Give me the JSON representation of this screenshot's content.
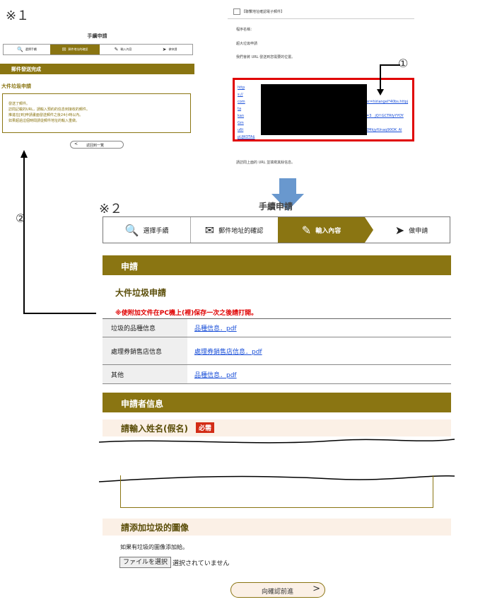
{
  "notes": {
    "n1": "※１",
    "n2": "※２",
    "circle1": "①",
    "circle2": "②"
  },
  "left_panel": {
    "title": "手續申請",
    "steps": [
      "選擇手續",
      "郵件地址的確認",
      "輸入內容",
      "做申請"
    ],
    "banner": "郵件發送完成",
    "subtitle": "大件垃圾申請",
    "box_lines": [
      "發送了郵件。",
      "訪問記載的URL，請輸入預約的信息到接收的郵件。",
      "推進在[到]申請畫面發送郵件之後24小時以內。",
      "如果超過這個時間請從郵件地址的輸入重做。"
    ],
    "back_button": "返回到一覽"
  },
  "email": {
    "header": "【聯繫地址確認電子郵件】",
    "line1": "程序名稱：",
    "line2": "超大垃圾申請",
    "line3": "我們會將 URL 發送到您需要的位置。",
    "url_parts": [
      "http",
      "s://",
      "com",
      "ta",
      "kan",
      "Gm",
      "u6t",
      "pUJKOTA$"
    ],
    "url_right": [
      "er=hiriangel*40bs.httpj",
      "=3__jQ!!GCTRfyYYOY",
      "2MkjyfUnaq90OK_Al"
    ],
    "footer": "請訪問上面的 URL 並填寫其餘信息。"
  },
  "main": {
    "title": "手續申請",
    "steps": [
      {
        "label": "選擇手續",
        "icon": "search-icon"
      },
      {
        "label": "郵件地址的確認",
        "icon": "envelope-icon"
      },
      {
        "label": "輸入內容",
        "icon": "pencil-icon"
      },
      {
        "label": "做申請",
        "icon": "send-icon"
      }
    ],
    "section1": "申請",
    "subtitle": "大件垃圾申請",
    "warning": "※使附加文件在PC機上(裡)保存一次之後請打開。",
    "rows": [
      {
        "label": "垃圾的品種信息",
        "value": "品種信息．pdf"
      },
      {
        "label": "處理券銷售店信息",
        "value": "處理券銷售店信息．pdf"
      },
      {
        "label": "其他",
        "value": "品種信息．pdf"
      }
    ],
    "section2": "申請者信息",
    "name_label": "請輸入姓名(假名)",
    "required": "必需",
    "image_label": "請添加垃圾的圖像",
    "image_note": "如果有垃圾的圖像添加給。",
    "file_button": "ファイルを選択",
    "file_status": "選択されていません",
    "confirm_button": "向確認前進"
  },
  "colors": {
    "olive": "#8a7512",
    "red": "#e00000",
    "arrow_blue": "#4f86c6"
  }
}
